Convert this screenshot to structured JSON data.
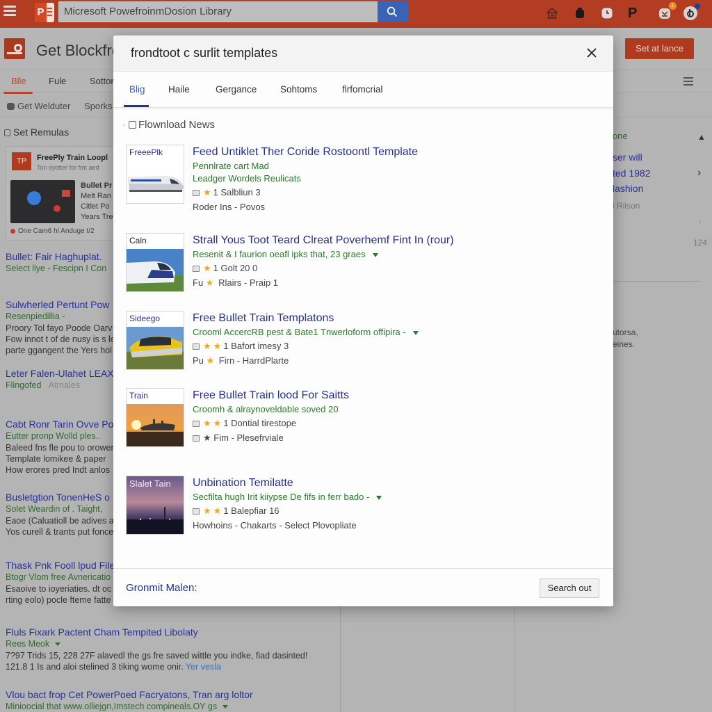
{
  "topbar": {
    "search_value": "Micresoft PowefroinmDosion Library",
    "icons": [
      "home-icon",
      "bag-icon",
      "clock-icon",
      "p-icon",
      "notifications-icon",
      "account-icon"
    ],
    "notification_badge": "1"
  },
  "background": {
    "title": "Get Blockfron",
    "set_balance_label": "Set at lance",
    "tabs": [
      "Blle",
      "Fule",
      "Sotton"
    ],
    "active_tab": "Blle",
    "subnav": [
      "Get Welduter",
      "Sporks"
    ],
    "section_label": "Set Remulas",
    "card": {
      "logo_text": "TP",
      "title": "FreePly Train Loopl",
      "subtitle": "Ton syotter for fmt aed",
      "side_lines": [
        "Bullet Pr",
        "Melt Ran",
        "Citlet Po",
        "Years Tre"
      ],
      "footer": "One Cam6 hl Anduge t/2"
    },
    "results": [
      {
        "title": "Bullet: Fair Haghuplat.",
        "green": "Select liye  -  Fescipn I Con",
        "desc": []
      },
      {
        "title": "Sulwherled Pertunt Pow",
        "green": "Resenpiedillia  -",
        "desc": [
          "Proory Tol fayo Poode Oarv",
          "Fow innot t of de nusy is s lev",
          "parte ggangent the Yers hol"
        ]
      },
      {
        "title": "Leter Falen-Ulahet LEAXE",
        "green": "Flingofed",
        "link": "Atmales",
        "desc": []
      },
      {
        "title": "Cabt Ronr Tarin Ovve Po",
        "green": "Eutter pronp Wolld ples..",
        "desc": [
          "Baleed fns fle pou to orower",
          "Template lomikee & paper",
          "How erores pred Indt anlos"
        ]
      },
      {
        "title": "Busletgtion TonenHeS o",
        "green": "Solet Weardin of . Taight,",
        "desc": [
          "Eaoe (Caluatioll be adives a",
          "Yos curell & trants put fonce"
        ]
      },
      {
        "title": "Thask Pnk Fooll lpud File",
        "green": "Btogr Vlom free Avnericatio",
        "desc": [
          "Esaoive to ioyeriaties. dt oc",
          "rting eolo) pocle fteme fatte"
        ]
      },
      {
        "title": "Fluls Fixark Pactent Cham Tempited Libolaty",
        "green": "Rees Meok",
        "desc": [
          "7?97 Trids 15, 228 27F alavedl the gs fre saved wittle you indke, fiad dasinted!",
          "121.8 1 Is and aloi stelined 3 tiking wome onir."
        ],
        "link": "Yer vesla"
      },
      {
        "title": "Vlou bact frop Cet PowerPoed Facryatons, Tran arg loltor",
        "green": "Minioocial that www.olliejgn,Imstech compineals.OY gs",
        "desc": []
      }
    ],
    "right_panel": {
      "lines": [
        "one",
        "ser will",
        "ted 1982",
        "lashion",
        "l Rilson",
        "124",
        "utorsa,",
        "eines."
      ]
    }
  },
  "modal": {
    "title": "frondtoot c surlit templates",
    "tabs": [
      "Blig",
      "Haile",
      "Gergance",
      "Sohtoms",
      "flrfomcrial"
    ],
    "active_tab": "Blig",
    "section_heading": "Flownload News",
    "results": [
      {
        "thumb_label": "FreeePlk",
        "title": "Feed Untiklet Ther Coride Rostoontl Template",
        "green": [
          "Pennlrate cart Mad",
          "Leadger Wordels Reulicats"
        ],
        "meta1": "1 Salbliun 3",
        "meta1_stars": 1,
        "meta2": "Roder Ins  -  Povos",
        "meta2_star": false,
        "has_caret": false
      },
      {
        "thumb_label": "Caln",
        "title": "Strall Yous Toot Teard Clreat Poverhemf Fint In (rour)",
        "green": [
          "Resenit & I faurion oeafl ipks that, 23 graes"
        ],
        "meta1": "1 Golt  20 0",
        "meta1_stars": 1,
        "meta2": "Fu ★ Rlairs  -  Praip 1",
        "meta2_star": true,
        "has_caret": true
      },
      {
        "thumb_label": "Sideego",
        "title": "Free Bullet Train Templatons",
        "green": [
          "Crooml AccercRB pest & Bate1 Tnwerloform offipira  -"
        ],
        "meta1": "1 Bafort imesy 3",
        "meta1_stars": 2,
        "meta2": "Pu ★ Firn  -  HarrdPlarte",
        "meta2_star": true,
        "has_caret": true
      },
      {
        "thumb_label": "Train",
        "title": "Free Bullet Train lood For Saitts",
        "green": [
          "Croomh & alraynoveldable soved 20"
        ],
        "meta1": "1 Dontial tirestope",
        "meta1_stars": 2,
        "meta2": "★ Fim  -  Plesefrviale",
        "meta2_star": true,
        "has_caret": false
      },
      {
        "thumb_label": "Slalet Tain",
        "title": "Unbination Temilatte",
        "green": [
          "Secfilta hugh Irit kiiypse De fifs in ferr bado  -"
        ],
        "meta1": "1 Balepfiar 16",
        "meta1_stars": 2,
        "meta2": "Howhoins  -  Chakarts  -  Select Plovopliate",
        "meta2_star": false,
        "has_caret": true
      }
    ],
    "footer_label": "Gronmit Malen:",
    "footer_button": "Search out"
  }
}
